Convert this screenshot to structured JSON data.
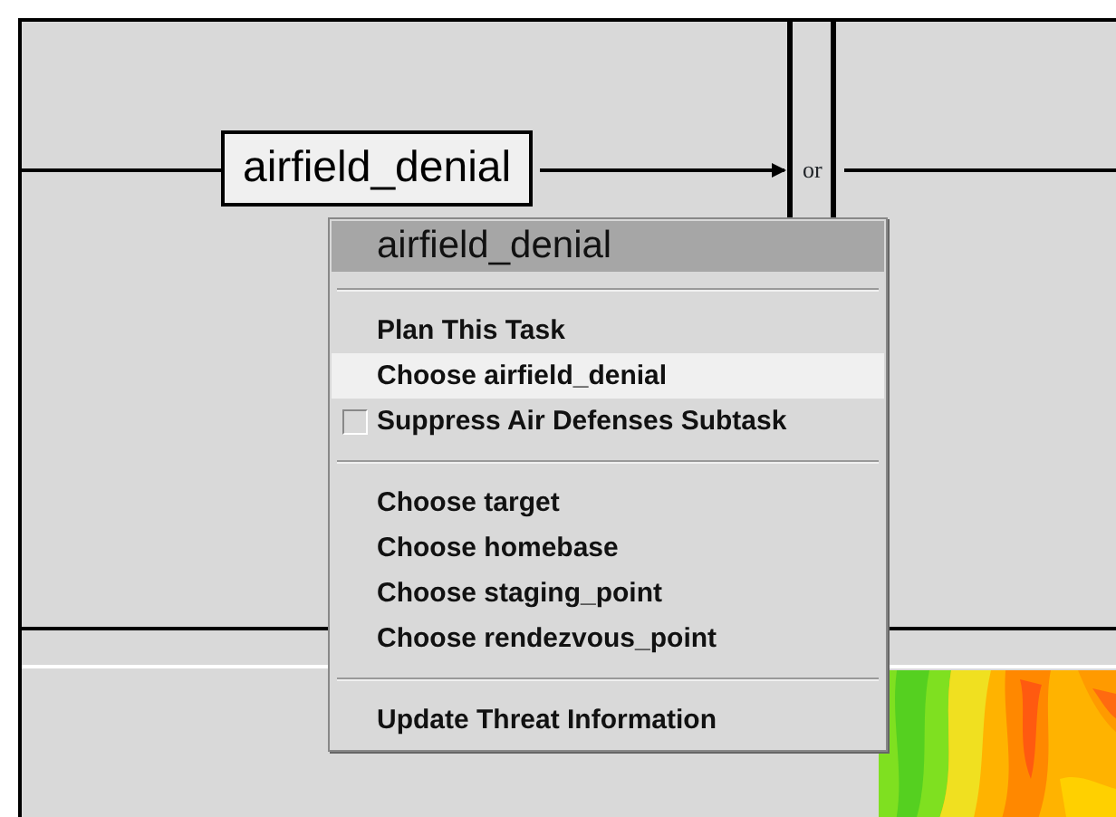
{
  "diagram": {
    "node": {
      "label": "airfield_denial"
    },
    "connector": {
      "label": "or"
    }
  },
  "context_menu": {
    "title": "airfield_denial",
    "items": [
      {
        "kind": "separator"
      },
      {
        "kind": "action",
        "label": "Plan This Task",
        "selected": false
      },
      {
        "kind": "action",
        "label": "Choose airfield_denial",
        "selected": true
      },
      {
        "kind": "check",
        "label": "Suppress Air Defenses Subtask",
        "checked": false,
        "selected": false
      },
      {
        "kind": "separator"
      },
      {
        "kind": "action",
        "label": "Choose target",
        "selected": false
      },
      {
        "kind": "action",
        "label": "Choose homebase",
        "selected": false
      },
      {
        "kind": "action",
        "label": "Choose staging_point",
        "selected": false
      },
      {
        "kind": "action",
        "label": "Choose rendezvous_point",
        "selected": false
      },
      {
        "kind": "separator"
      },
      {
        "kind": "action",
        "label": "Update Threat Information",
        "selected": false
      }
    ]
  }
}
